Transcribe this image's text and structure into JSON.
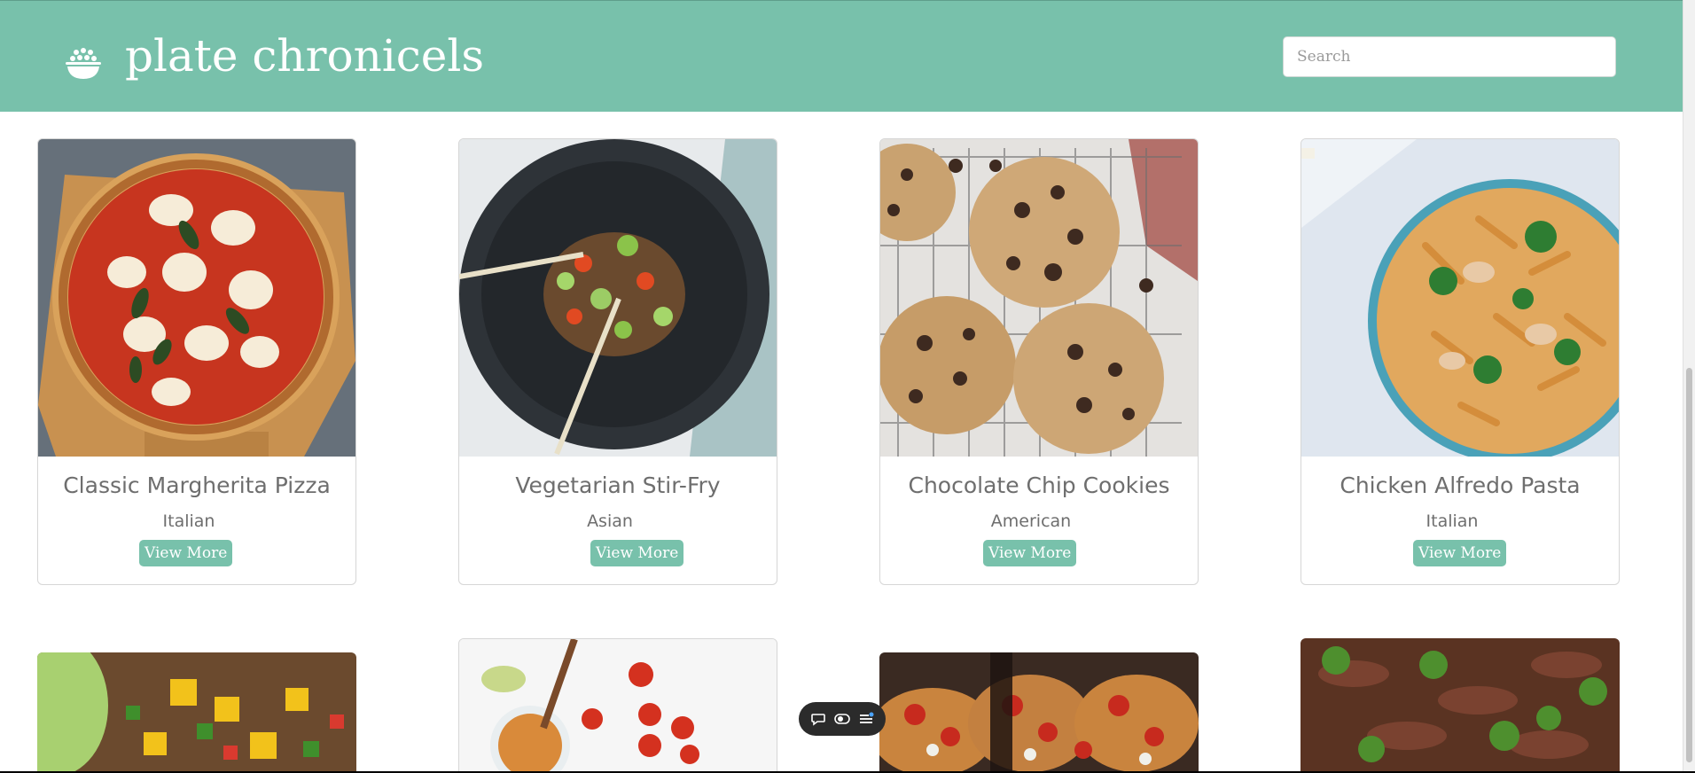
{
  "header": {
    "title": "plate chronicels",
    "logo_icon": "rice-bowl-icon",
    "search": {
      "placeholder": "Search",
      "value": ""
    },
    "background": "#78c1ab"
  },
  "recipes": [
    {
      "title": "Classic Margherita Pizza",
      "cuisine": "Italian",
      "button": "View More",
      "image": "margherita-pizza-photo"
    },
    {
      "title": "Vegetarian Stir-Fry",
      "cuisine": "Asian",
      "button": "View More",
      "image": "stir-fry-bowl-photo"
    },
    {
      "title": "Chocolate Chip Cookies",
      "cuisine": "American",
      "button": "View More",
      "image": "cookies-rack-photo"
    },
    {
      "title": "Chicken Alfredo Pasta",
      "cuisine": "Italian",
      "button": "View More",
      "image": "alfredo-pasta-photo"
    }
  ],
  "row2_images": [
    "mango-salsa-photo",
    "sauce-jar-tomatoes-photo",
    "bruschetta-photo",
    "beef-broccoli-photo"
  ],
  "toolbar": {
    "icons": [
      "comment-icon",
      "toggle-icon",
      "list-icon"
    ]
  },
  "colors": {
    "accent": "#78c1ab",
    "text": "#6e6e6e"
  }
}
